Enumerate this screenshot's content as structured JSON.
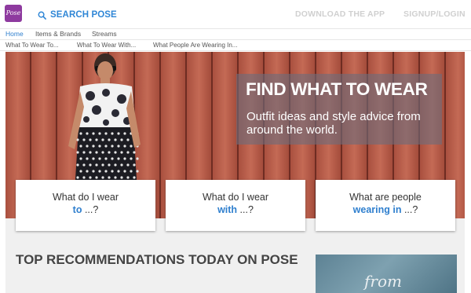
{
  "brand": {
    "logo_text": "Pose",
    "logo_color": "#8e3a9f"
  },
  "header": {
    "search_label": "SEARCH POSE",
    "download_label": "DOWNLOAD THE APP",
    "signup_label": "SIGNUP/LOGIN"
  },
  "nav": {
    "primary": [
      "Home",
      "Items & Brands",
      "Streams"
    ],
    "secondary": [
      "What To Wear To...",
      "What To Wear With...",
      "What People Are Wearing In..."
    ]
  },
  "hero": {
    "title": "FIND WHAT TO WEAR",
    "subtitle": "Outfit ideas and style advice from around the world."
  },
  "cards": [
    {
      "line1": "What do I wear",
      "highlight": "to",
      "suffix": " ...?"
    },
    {
      "line1": "What do I wear",
      "highlight": "with",
      "suffix": " ...?"
    },
    {
      "line1": "What are people",
      "highlight": "wearing in",
      "suffix": " ...?"
    }
  ],
  "recommendations": {
    "title": "TOP RECOMMENDATIONS TODAY ON POSE",
    "thumb_text": "from"
  },
  "colors": {
    "accent": "#2f7fce",
    "brand": "#8e3a9f",
    "muted": "#d0d0d0"
  }
}
